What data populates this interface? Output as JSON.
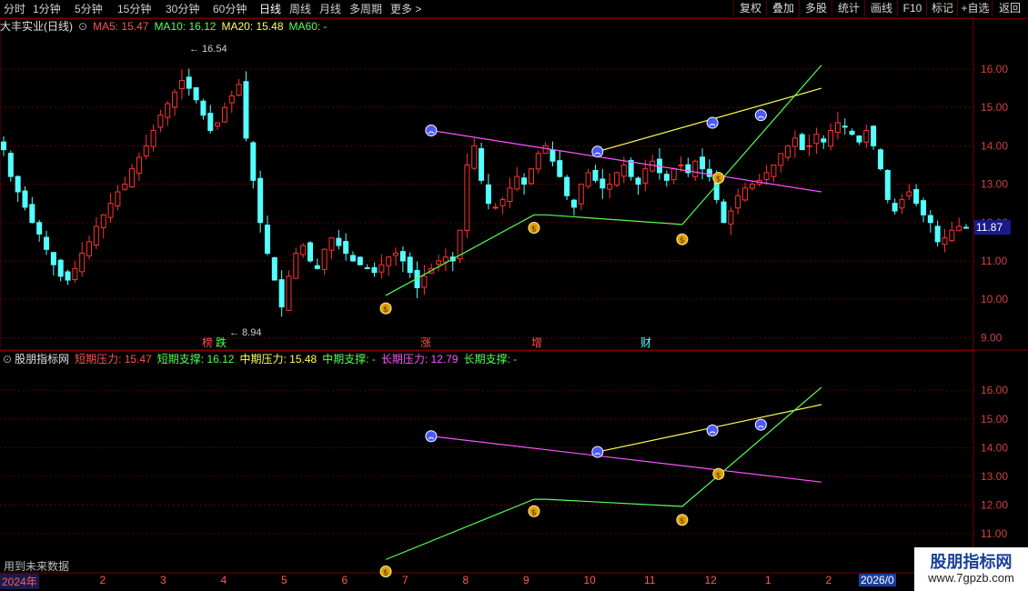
{
  "toolbar": {
    "periods": [
      "分时",
      "1分钟",
      "5分钟",
      "15分钟",
      "30分钟",
      "60分钟",
      "日线",
      "周线",
      "月线",
      "多周期",
      "更多 >"
    ],
    "active_period": "日线",
    "buttons": [
      "复权",
      "叠加",
      "多股",
      "统计",
      "画线",
      "F10",
      "标记",
      "+自选",
      "返回"
    ]
  },
  "main_header": {
    "stock": "大丰实业(日线)",
    "ma5": "MA5: 15.47",
    "ma10": "MA10: 16.12",
    "ma20": "MA20: 15.48",
    "ma60": "MA60: -"
  },
  "indicator_header": {
    "name": "股朋指标网",
    "items": [
      "短期压力: 15.47",
      "短期支撑: 16.12",
      "中期压力: 15.48",
      "中期支撑: -",
      "长期压力: 12.79",
      "长期支撑: -"
    ]
  },
  "colors": {
    "up": "#ff3232",
    "down": "#54ffff",
    "short_line": "#ffff54",
    "mid_line": "#ff54ff",
    "long_line": "#54ff54",
    "grid": "#7a0000"
  },
  "markers": {
    "high_label": "16.54",
    "low_label": "8.94",
    "current_price": "11.87",
    "events": [
      "榜",
      "跌",
      "涨",
      "增",
      "财"
    ]
  },
  "timebar": {
    "year_label": "2024年",
    "months": [
      "1",
      "2",
      "3",
      "4",
      "5",
      "6",
      "7",
      "8",
      "9",
      "10",
      "11",
      "12",
      "1",
      "2"
    ],
    "end_label": "2026/0"
  },
  "footer": {
    "future_note": "用到未来数据",
    "watermark_title": "股朋指标网",
    "watermark_url": "www.7gpzb.com"
  },
  "chart_data": [
    {
      "type": "candlestick",
      "ylim": [
        8.7,
        16.9
      ],
      "y_ticks": [
        "16.00",
        "15.00",
        "14.00",
        "13.00",
        "12.00",
        "11.00",
        "10.00",
        "9.00"
      ],
      "ohlc_close_path": [
        13.9,
        13.2,
        12.8,
        12.4,
        12.0,
        11.7,
        11.3,
        10.9,
        10.6,
        10.5,
        10.8,
        11.2,
        11.5,
        11.9,
        12.2,
        12.5,
        12.8,
        13.0,
        13.4,
        13.7,
        14.0,
        14.4,
        14.8,
        15.1,
        15.4,
        15.7,
        15.5,
        15.2,
        14.8,
        14.4,
        14.6,
        15.0,
        15.3,
        15.6,
        14.2,
        13.1,
        12.0,
        11.2,
        10.5,
        9.8,
        10.6,
        11.2,
        11.4,
        11.0,
        10.8,
        11.3,
        11.6,
        11.4,
        11.2,
        11.0,
        10.9,
        10.8,
        10.7,
        10.9,
        11.1,
        11.2,
        11.0,
        10.7,
        10.3,
        10.6,
        10.8,
        11.0,
        11.1,
        11.0,
        11.8,
        13.5,
        14.0,
        13.1,
        12.5,
        12.4,
        12.6,
        12.9,
        13.2,
        13.0,
        13.4,
        13.8,
        14.0,
        13.6,
        13.2,
        12.7,
        12.4,
        13.0,
        13.3,
        13.1,
        12.9,
        13.0,
        13.3,
        13.5,
        13.2,
        13.0,
        13.4,
        13.6,
        13.3,
        13.1,
        13.4,
        13.5,
        13.3,
        13.6,
        13.4,
        13.2,
        12.6,
        12.0,
        12.3,
        12.7,
        12.9,
        13.0,
        13.1,
        13.3,
        13.5,
        13.8,
        14.0,
        14.2,
        13.9,
        14.0,
        14.3,
        14.1,
        14.4,
        14.6,
        14.5,
        14.3,
        14.1,
        14.4,
        14.0,
        13.4,
        12.6,
        12.3,
        12.6,
        12.8,
        12.5,
        12.2,
        12.0,
        11.5,
        11.6,
        11.8,
        11.9,
        11.87
      ]
    },
    {
      "type": "line",
      "title": "股朋指标网",
      "series": [
        {
          "name": "短期压力",
          "x": [
            10.2,
            13.9
          ],
          "y": [
            13.85,
            15.5
          ],
          "color": "#ffff54"
        },
        {
          "name": "中期压力",
          "x": [
            7.45,
            13.9
          ],
          "y": [
            14.4,
            12.8
          ],
          "color": "#ff54ff"
        },
        {
          "name": "长期支撑",
          "x": [
            6.7,
            9.15,
            9.35,
            11.6,
            13.9
          ],
          "y": [
            10.1,
            12.2,
            12.2,
            11.95,
            16.1
          ],
          "color": "#54ff54"
        }
      ],
      "pivots_high": [
        [
          7.45,
          14.4
        ],
        [
          10.2,
          13.85
        ],
        [
          12.1,
          14.6
        ],
        [
          12.9,
          14.8
        ]
      ],
      "pivots_low": [
        [
          6.7,
          10.0
        ],
        [
          9.15,
          12.1
        ],
        [
          11.6,
          11.8
        ],
        [
          12.2,
          13.4
        ]
      ],
      "ylim": [
        10.0,
        16.5
      ]
    }
  ]
}
